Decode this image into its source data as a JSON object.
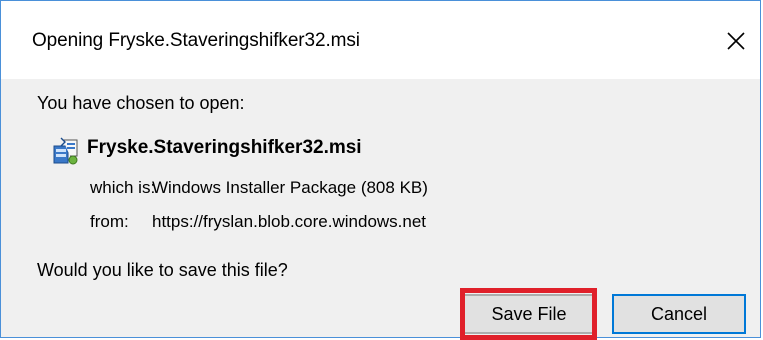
{
  "dialog": {
    "title": "Opening Fryske.Staveringshifker32.msi",
    "close_icon": "close-icon"
  },
  "content": {
    "intro": "You have chosen to open:",
    "file_icon": "installer-package-icon",
    "file_name": "Fryske.Staveringshifker32.msi",
    "which_is_label": "which is:",
    "which_is_value": "Windows Installer Package (808 KB)",
    "from_label": "from:",
    "from_value": "https://fryslan.blob.core.windows.net",
    "question": "Would you like to save this file?"
  },
  "buttons": {
    "save_label": "Save File",
    "cancel_label": "Cancel"
  },
  "colors": {
    "highlight": "#e0202a",
    "focus_border": "#0078d7",
    "window_border": "#4a90d9"
  }
}
